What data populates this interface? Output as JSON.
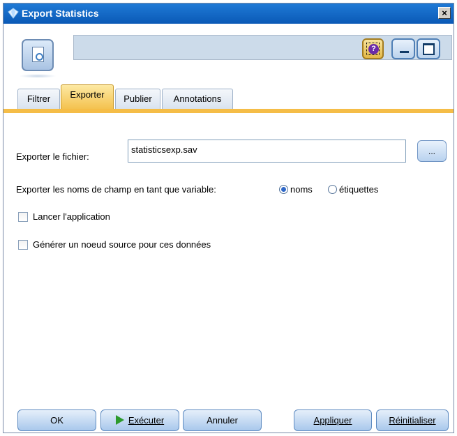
{
  "window": {
    "title": "Export Statistics",
    "close_glyph": "×"
  },
  "header": {
    "node_icon": "statistics-export-node-icon",
    "help_glyph": "?"
  },
  "tabs": [
    {
      "label": "Filtrer",
      "active": false
    },
    {
      "label": "Exporter",
      "active": true
    },
    {
      "label": "Publier",
      "active": false
    },
    {
      "label": "Annotations",
      "active": false
    }
  ],
  "form": {
    "file_label": "Exporter le fichier:",
    "file_value": "statisticsexp.sav",
    "browse_label": "...",
    "names_label": "Exporter les noms de champ en tant que variable:",
    "radio_options": [
      {
        "label": "noms",
        "selected": true
      },
      {
        "label": "étiquettes",
        "selected": false
      }
    ],
    "launch_label": "Lancer l'application",
    "launch_checked": false,
    "generate_label": "Générer un noeud source pour ces données",
    "generate_checked": false
  },
  "footer": {
    "ok": "OK",
    "run": "Exécuter",
    "cancel": "Annuler",
    "apply": "Appliquer",
    "reset": "Réinitialiser"
  },
  "colors": {
    "titlebar": "#0a59b6",
    "active_tab": "#f4c24f",
    "tab_underline": "#f5bd47",
    "header_bar": "#ccdbea"
  }
}
